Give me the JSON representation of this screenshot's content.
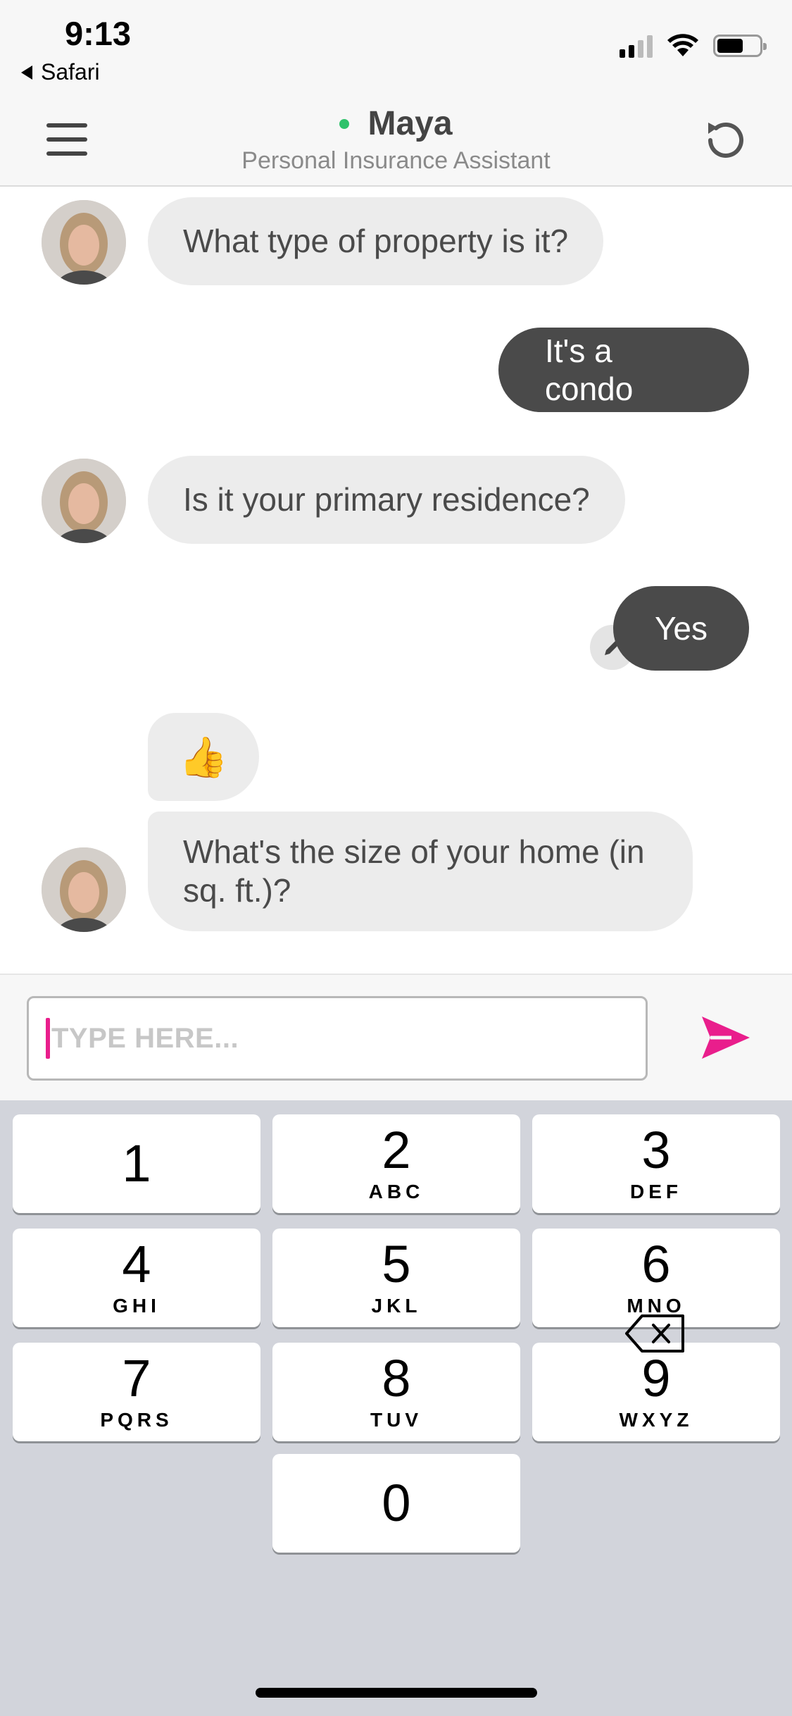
{
  "status_bar": {
    "time": "9:13",
    "back_label": "Safari"
  },
  "header": {
    "name": "Maya",
    "subtitle": "Personal Insurance Assistant"
  },
  "messages": [
    {
      "from": "bot",
      "text": "What type of property is it?"
    },
    {
      "from": "user",
      "text": "It's a condo"
    },
    {
      "from": "bot",
      "text": "Is it your primary residence?"
    },
    {
      "from": "user",
      "text": "Yes"
    },
    {
      "from": "bot",
      "text": "👍"
    },
    {
      "from": "bot",
      "text": "What's the size of your home (in sq. ft.)?"
    }
  ],
  "input": {
    "placeholder": "TYPE HERE..."
  },
  "keyboard": {
    "keys": [
      {
        "num": "1",
        "letters": ""
      },
      {
        "num": "2",
        "letters": "ABC"
      },
      {
        "num": "3",
        "letters": "DEF"
      },
      {
        "num": "4",
        "letters": "GHI"
      },
      {
        "num": "5",
        "letters": "JKL"
      },
      {
        "num": "6",
        "letters": "MNO"
      },
      {
        "num": "7",
        "letters": "PQRS"
      },
      {
        "num": "8",
        "letters": "TUV"
      },
      {
        "num": "9",
        "letters": "WXYZ"
      },
      {
        "num": "0",
        "letters": ""
      }
    ]
  },
  "colors": {
    "accent": "#e91e8c",
    "online": "#2fc26b",
    "user_bubble": "#4a4a4a",
    "bot_bubble": "#ececec"
  }
}
